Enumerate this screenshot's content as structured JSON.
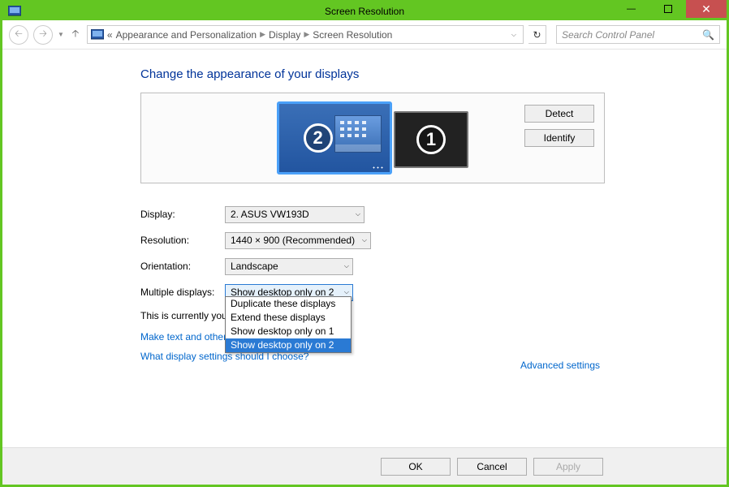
{
  "window": {
    "title": "Screen Resolution"
  },
  "breadcrumb": {
    "root_marker": "«",
    "items": [
      "Appearance and Personalization",
      "Display",
      "Screen Resolution"
    ]
  },
  "search": {
    "placeholder": "Search Control Panel"
  },
  "heading": "Change the appearance of your displays",
  "monitors": {
    "primary_label": "2",
    "secondary_label": "1"
  },
  "buttons": {
    "detect": "Detect",
    "identify": "Identify",
    "ok": "OK",
    "cancel": "Cancel",
    "apply": "Apply"
  },
  "form": {
    "display_label": "Display:",
    "display_value": "2. ASUS VW193D",
    "resolution_label": "Resolution:",
    "resolution_value": "1440 × 900 (Recommended)",
    "orientation_label": "Orientation:",
    "orientation_value": "Landscape",
    "multiple_label": "Multiple displays:",
    "multiple_value": "Show desktop only on 2",
    "multiple_options": [
      "Duplicate these displays",
      "Extend these displays",
      "Show desktop only on 1",
      "Show desktop only on 2"
    ],
    "main_screen_msg": "This is currently you"
  },
  "links": {
    "advanced": "Advanced settings",
    "text_size": "Make text and other",
    "help": "What display settings should I choose?"
  }
}
